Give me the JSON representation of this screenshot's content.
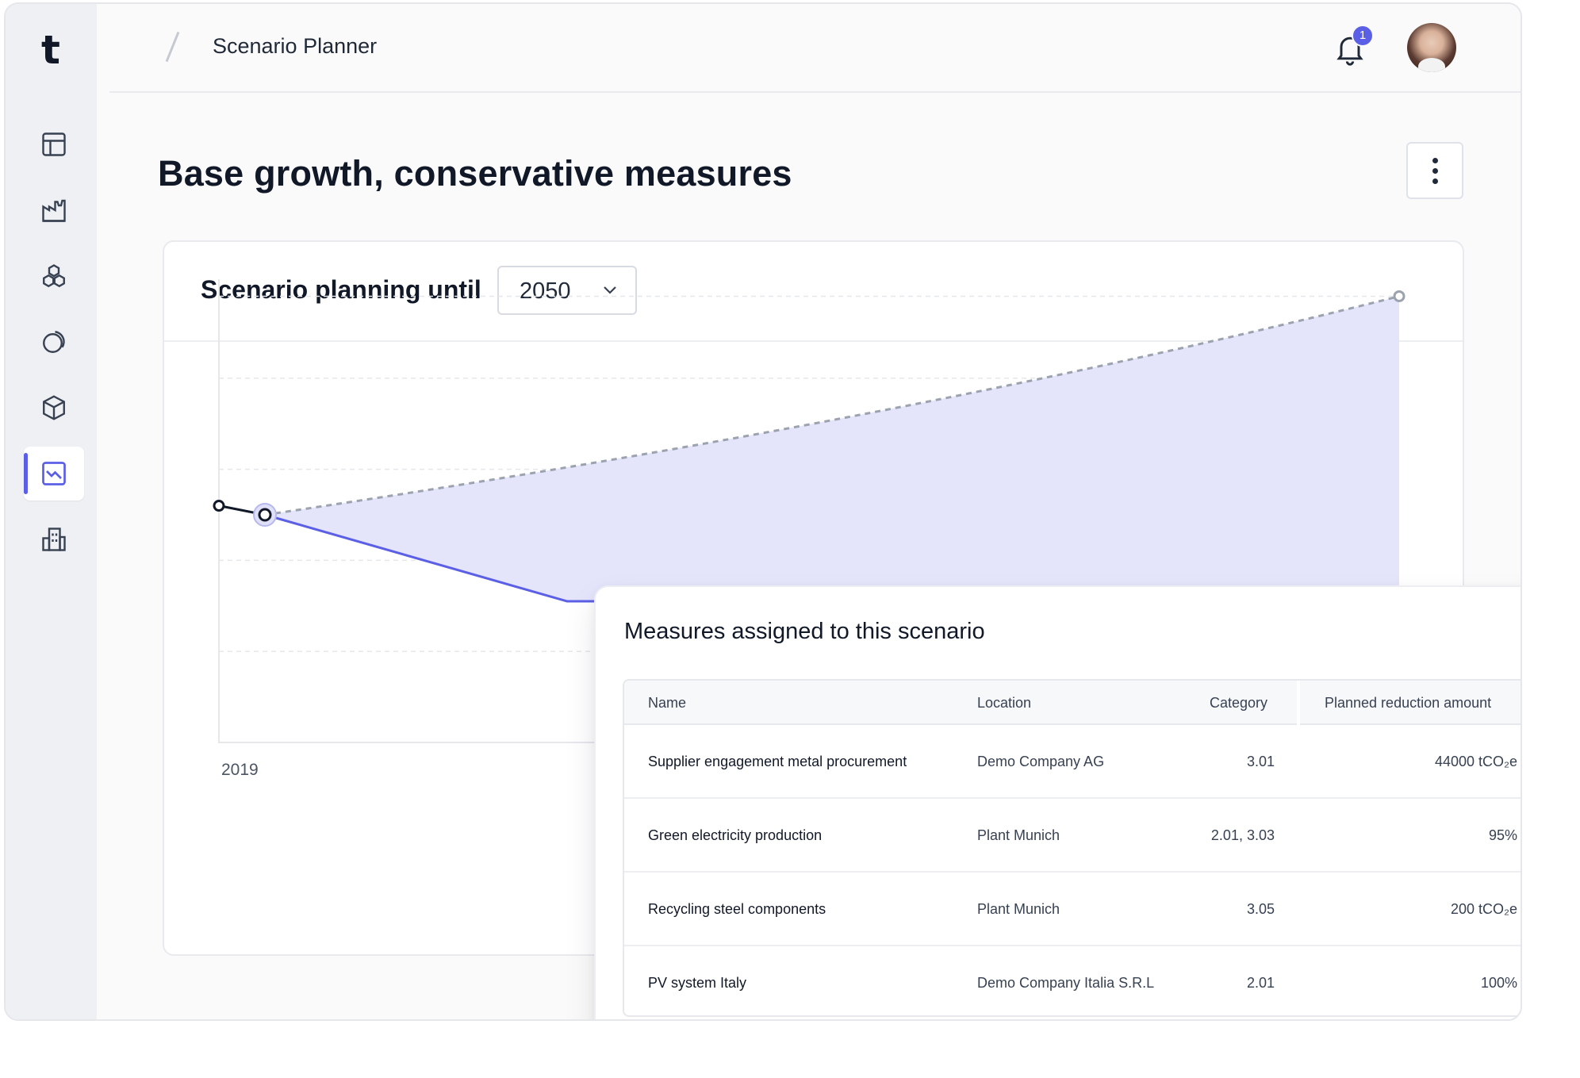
{
  "app": {
    "breadcrumb": "Scenario Planner",
    "notifications_count": "1",
    "logo_letter": "t"
  },
  "sidebar": {
    "items": [
      {
        "icon": "layout-icon",
        "active": false
      },
      {
        "icon": "factory-icon",
        "active": false
      },
      {
        "icon": "hexagons-icon",
        "active": false
      },
      {
        "icon": "circle-swirl-icon",
        "active": false
      },
      {
        "icon": "box-icon",
        "active": false
      },
      {
        "icon": "chart-trend-icon",
        "active": true
      },
      {
        "icon": "building-icon",
        "active": false
      }
    ]
  },
  "page": {
    "title": "Base growth, conservative measures"
  },
  "scenario": {
    "label": "Scenario planning until",
    "year": "2050"
  },
  "chart_data": {
    "type": "area",
    "xlabel": "",
    "ylabel": "",
    "x_tick_labels": [
      "2019"
    ],
    "colors": {
      "reduction_line": "#5b5fe6",
      "fill": "#e4e4fb",
      "baseline": "#9ca3af",
      "historic": "#111827"
    },
    "series": [
      {
        "values": [
          0.52,
          0.5
        ]
      },
      {
        "values": [
          0.5,
          0.98
        ]
      },
      {
        "values": [
          0.5,
          0.31,
          0.31
        ]
      }
    ]
  },
  "measures": {
    "title": "Measures assigned to this scenario",
    "columns": [
      "Name",
      "Location",
      "Category",
      "Planned reduction amount"
    ],
    "rows": [
      {
        "name": "Supplier engagement metal procurement",
        "location": "Demo Company AG",
        "category": "3.01",
        "amount": "44000 tCO₂e"
      },
      {
        "name": "Green electricity production",
        "location": "Plant Munich",
        "category": "2.01, 3.03",
        "amount": "95%"
      },
      {
        "name": "Recycling steel components",
        "location": "Plant Munich",
        "category": "3.05",
        "amount": "200 tCO₂e"
      },
      {
        "name": "PV system Italy",
        "location": "Demo Company Italia S.R.L",
        "category": "2.01",
        "amount": "100%"
      }
    ]
  }
}
